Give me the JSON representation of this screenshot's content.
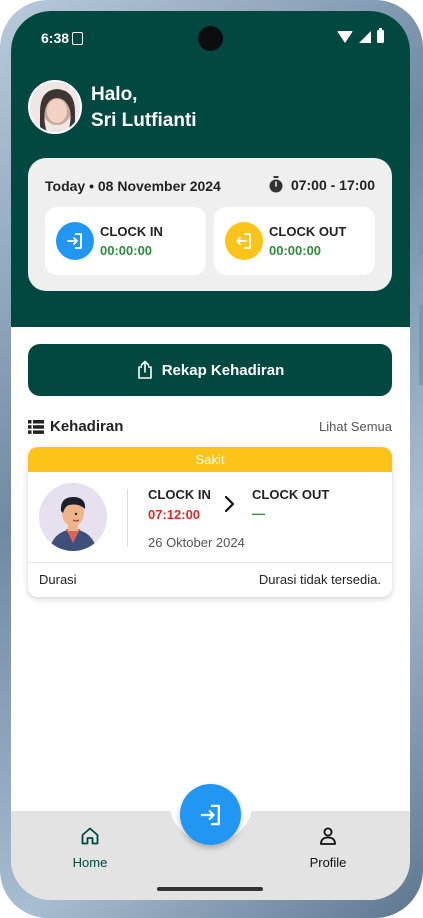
{
  "status_bar": {
    "time": "6:38"
  },
  "greeting": {
    "line1": "Halo,",
    "name": "Sri Lutfianti"
  },
  "time_card": {
    "date": "Today • 08 November 2024",
    "shift_hours": "07:00 - 17:00",
    "clock_in": {
      "label": "CLOCK IN",
      "value": "00:00:00",
      "icon": "login-icon",
      "color": "#2196f3"
    },
    "clock_out": {
      "label": "CLOCK OUT",
      "value": "00:00:00",
      "icon": "logout-icon",
      "color": "#fcc419"
    }
  },
  "rekap_button": {
    "label": "Rekap Kehadiran",
    "icon": "share-icon"
  },
  "attendance_section": {
    "title": "Kehadiran",
    "see_all": "Lihat Semua",
    "items": [
      {
        "status": "Sakit",
        "status_color": "#fcc419",
        "clock_in_label": "CLOCK IN",
        "clock_in_value": "07:12:00",
        "clock_out_label": "CLOCK OUT",
        "clock_out_value": "—",
        "date": "26 Oktober 2024",
        "duration_label": "Durasi",
        "duration_value": "Durasi tidak tersedia."
      }
    ]
  },
  "bottom_nav": {
    "home_label": "Home",
    "profile_label": "Profile",
    "fab_icon": "login-icon",
    "active": "Home"
  },
  "colors": {
    "primary": "#014841",
    "accent_blue": "#2196f3",
    "accent_yellow": "#fcc419",
    "success": "#2e8b3a",
    "danger": "#d62b2b"
  }
}
